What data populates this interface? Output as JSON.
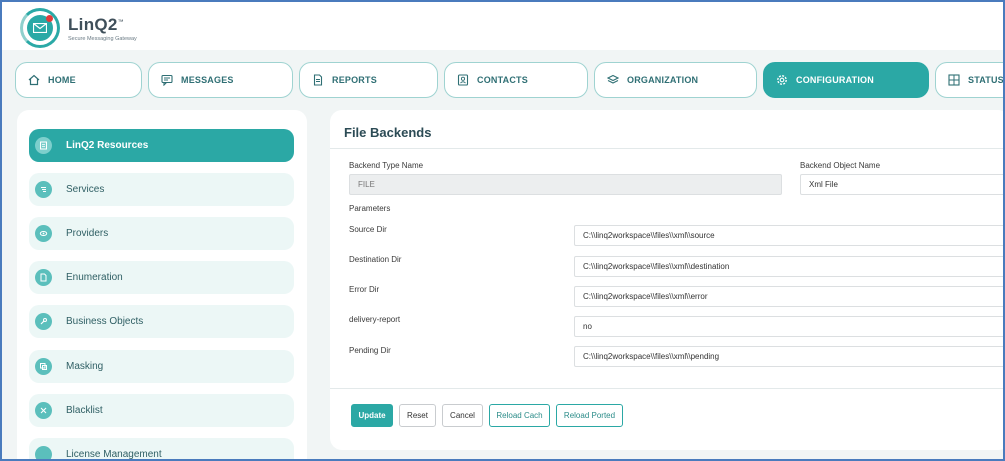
{
  "brand": {
    "name": "LinQ2",
    "trademark": "™",
    "tagline": "Secure Messaging Gateway"
  },
  "nav": {
    "tabs": [
      {
        "label": "HOME",
        "icon": "home-icon"
      },
      {
        "label": "MESSAGES",
        "icon": "messages-icon"
      },
      {
        "label": "REPORTS",
        "icon": "reports-icon"
      },
      {
        "label": "CONTACTS",
        "icon": "contacts-icon"
      },
      {
        "label": "ORGANIZATION",
        "icon": "layers-icon"
      },
      {
        "label": "CONFIGURATION",
        "icon": "gear-icon",
        "active": true
      },
      {
        "label": "STATUS M",
        "icon": "grid-icon"
      }
    ]
  },
  "sidebar": {
    "items": [
      {
        "label": "LinQ2 Resources",
        "icon": "resources-icon",
        "active": true
      },
      {
        "label": "Services",
        "icon": "services-icon"
      },
      {
        "label": "Providers",
        "icon": "providers-icon"
      },
      {
        "label": "Enumeration",
        "icon": "document-icon"
      },
      {
        "label": "Business Objects",
        "icon": "wrench-icon"
      },
      {
        "label": "Masking",
        "icon": "copy-icon"
      },
      {
        "label": "Blacklist",
        "icon": "block-icon"
      },
      {
        "label": "License Management",
        "icon": "license-icon"
      }
    ]
  },
  "panel": {
    "title": "File Backends",
    "backend_type": {
      "label": "Backend Type Name",
      "value": "FILE"
    },
    "backend_object": {
      "label": "Backend Object Name",
      "value": "Xml File"
    },
    "parameters_label": "Parameters",
    "params": [
      {
        "label": "Source Dir",
        "value": "C:\\\\linq2workspace\\\\files\\\\xml\\\\source"
      },
      {
        "label": "Destination Dir",
        "value": "C:\\\\linq2workspace\\\\files\\\\xml\\\\destination"
      },
      {
        "label": "Error Dir",
        "value": "C:\\\\linq2workspace\\\\files\\\\xml\\\\error"
      },
      {
        "label": "delivery-report",
        "value": "no"
      },
      {
        "label": "Pending Dir",
        "value": "C:\\\\linq2workspace\\\\files\\\\xml\\\\pending"
      }
    ],
    "buttons": {
      "update": "Update",
      "reset": "Reset",
      "cancel": "Cancel",
      "reload_cache": "Reload Cach",
      "reload_ported": "Reload Ported"
    }
  },
  "colors": {
    "accent": "#2ba8a5",
    "frame": "#4a7bbd"
  }
}
